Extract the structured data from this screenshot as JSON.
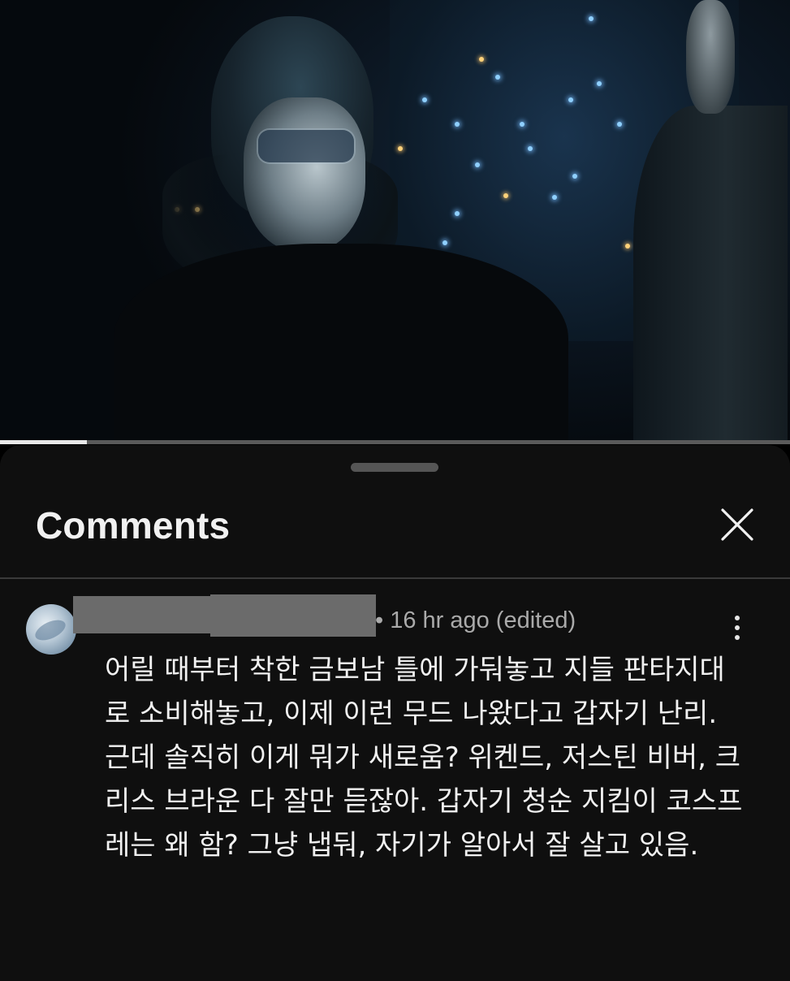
{
  "video": {
    "progress": 0.11
  },
  "sheet": {
    "title": "Comments",
    "close_icon": "close-icon"
  },
  "comment": {
    "author": "",
    "meta": "• 16 hr ago (edited)",
    "text": "어릴 때부터 착한 금보남 틀에 가둬놓고 지들 판타지대로 소비해놓고, 이제 이런 무드 나왔다고 갑자기 난리. 근데 솔직히 이게 뭐가 새로움? 위켄드, 저스틴 비버, 크리스 브라운 다 잘만 듣잖아. 갑자기 청순 지킴이 코스프레는 왜 함? 그냥 냅둬, 자기가 알아서 잘 살고 있음.",
    "more_icon": "more-vertical-icon"
  },
  "colors": {
    "sheet_bg": "#0f0f0f",
    "text_primary": "#f1f1f1",
    "text_secondary": "#aaaaaa",
    "progress_fill": "#e8e8e8",
    "progress_track": "#5a5a5a"
  }
}
